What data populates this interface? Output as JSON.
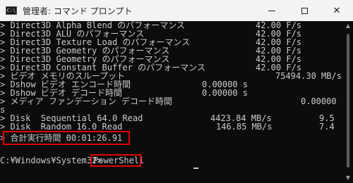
{
  "window": {
    "app_icon_glyph": "C:\\",
    "title": "管理者: コマンド プロンプト",
    "minimize": "",
    "maximize": "",
    "close": "✕"
  },
  "console": {
    "rows": [
      {
        "label": "> Direct3D Alpha Blend のパフォーマンス",
        "value": "42.00 F/s",
        "value2": ""
      },
      {
        "label": "> Direct3D ALU のパフォーマンス",
        "value": "42.00 F/s",
        "value2": ""
      },
      {
        "label": "> Direct3D Texture Load のパフォーマンス",
        "value": "42.00 F/s",
        "value2": ""
      },
      {
        "label": "> Direct3D Geometry のパフォーマンス",
        "value": "42.00 F/s",
        "value2": ""
      },
      {
        "label": "> Direct3D Geometry のパフォーマンス",
        "value": "42.00 F/s",
        "value2": ""
      },
      {
        "label": "> Direct3D Constant Buffer のパフォーマンス",
        "value": "42.00 F/s",
        "value2": ""
      },
      {
        "label": "> ビデオ メモリのスループット",
        "value": "75494.30 MB/s",
        "value2": ""
      },
      {
        "label": "> Dshow ビデオ エンコード時間",
        "value": "0.00000 s",
        "value2": ""
      },
      {
        "label": "> Dshow ビデオ デコード時間",
        "value": "0.00000 s",
        "value2": ""
      },
      {
        "label": "> メディア ファンデーション デコード時間",
        "value": "0.00000",
        "value2": ""
      },
      {
        "label": "s",
        "value": "",
        "value2": ""
      },
      {
        "label": "> Disk  Sequential 64.0 Read",
        "value": "4423.84 MB/s",
        "value2": "9.5"
      },
      {
        "label": "> Disk  Random 16.0 Read",
        "value": "146.85 MB/s",
        "value2": "7.4"
      },
      {
        "label": "> 合計実行時間 00:01:26.91",
        "value": "",
        "value2": ""
      }
    ],
    "prompt": "C:¥Windows¥System32>",
    "command": "PowerShell"
  }
}
